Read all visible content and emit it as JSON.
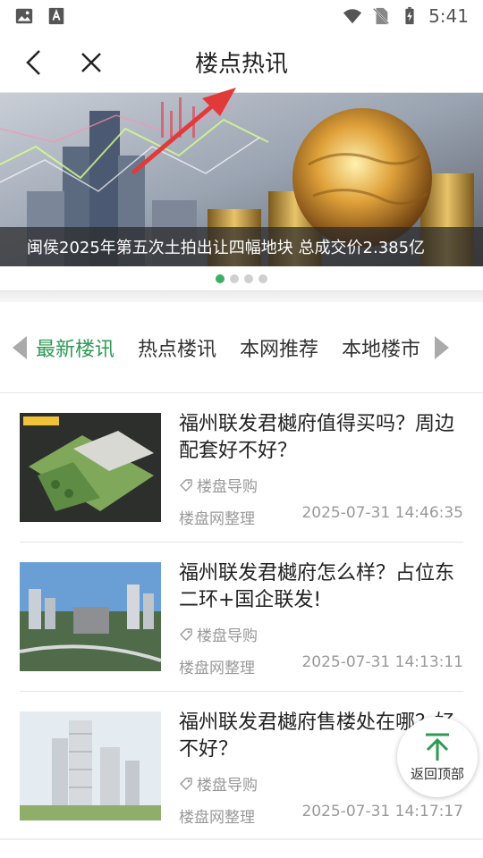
{
  "status_bar": {
    "time": "5:41"
  },
  "header": {
    "title": "楼点热讯"
  },
  "banner": {
    "caption": "闽侯2025年第五次土拍出让四幅地块 总成交价2.385亿",
    "dots_count": 4,
    "active_dot": 0
  },
  "tabs": [
    "最新楼讯",
    "热点楼讯",
    "本网推荐",
    "本地楼市"
  ],
  "active_tab": 0,
  "articles": [
    {
      "title": "福州联发君樾府值得买吗？周边配套好不好？",
      "tag": "楼盘导购",
      "source": "楼盘网整理",
      "date": "2025-07-31 14:46:35"
    },
    {
      "title": "福州联发君樾府怎么样？占位东二环+国企联发!",
      "tag": "楼盘导购",
      "source": "楼盘网整理",
      "date": "2025-07-31 14:13:11"
    },
    {
      "title": "福州联发君樾府售楼处在哪？好不好？",
      "tag": "楼盘导购",
      "source": "楼盘网整理",
      "date": "2025-07-31 14:17:17"
    }
  ],
  "back_to_top": {
    "label": "返回顶部"
  },
  "colors": {
    "accent": "#2e9a54",
    "active_dot": "#3daf65",
    "annotation_arrow": "#e03a3a"
  }
}
